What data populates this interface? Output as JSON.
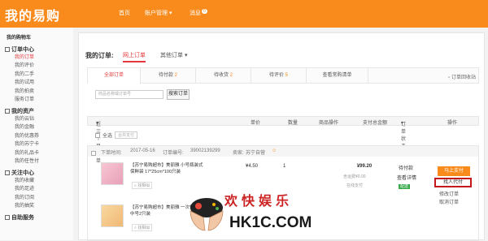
{
  "header": {
    "logo": "我的易购",
    "nav_home": "首页",
    "nav_account": "账户管理",
    "nav_messages": "消息",
    "messages_badge": "0"
  },
  "sidebar": {
    "cart": "我的购物车",
    "order_center": "订单中心",
    "order_items": [
      "我的订单",
      "我的评价",
      "我的二手",
      "我的试用",
      "我的拍卖",
      "服务订单"
    ],
    "assets": "我的资产",
    "asset_items": [
      "我的云钻",
      "我的金融",
      "我的优惠券",
      "我的苏宁卡",
      "我的礼品卡",
      "我的任性付"
    ],
    "follow_center": "关注中心",
    "follow_items": [
      "我的收藏",
      "我的足迹",
      "我的订阅",
      "我的抽奖"
    ],
    "self_service": "自助服务"
  },
  "main": {
    "title": "我的订单:",
    "tab_online": "网上订单",
    "tab_other": "其他订单",
    "subtabs": [
      {
        "label": "全部订单",
        "count": ""
      },
      {
        "label": "待付款",
        "count": "2"
      },
      {
        "label": "待收货",
        "count": "2"
      },
      {
        "label": "待评价",
        "count": "5"
      },
      {
        "label": "查看常购清单",
        "count": ""
      }
    ],
    "recycle": "订单回收站",
    "search_placeholder": "商品名称或订单号",
    "search_button": "搜索订单",
    "columns": {
      "period": "近三个月订单",
      "price": "单价",
      "qty": "数量",
      "goods_ops": "商品操作",
      "amount": "支付总金额",
      "status": "订单状态",
      "ops": "操作"
    },
    "select_all": "全选",
    "merge_pay": "合并支付",
    "order": {
      "time_label": "下单时间:",
      "time": "2017-05-16",
      "number_label": "订单编号:",
      "number": "39002139299",
      "seller_label": "卖家:",
      "seller": "苏宁自营",
      "items": [
        {
          "name": "【苏宁易购超市】美丽雅 小号瓶装式保鲜袋 17*25cm*100只装",
          "service": "找相似",
          "price": "¥4.50",
          "qty": "1"
        },
        {
          "name": "【苏宁易购超市】美丽雅 一次性手套中号2只装",
          "service": "找相似",
          "price": "",
          "qty": ""
        }
      ],
      "total": "¥99.20",
      "cloud_diamond": "含运费¥0.00",
      "pay_method": "在线支付",
      "status": "待付款",
      "view_detail": "查看详情",
      "delivery_tag": "配送",
      "pay_button": "马上支付",
      "other_pay": "找人代付",
      "edit_order": "修改订单",
      "cancel_order": "取消订单"
    }
  },
  "watermark": {
    "cn": "欢快娱乐",
    "site": "HK1C.COM"
  }
}
